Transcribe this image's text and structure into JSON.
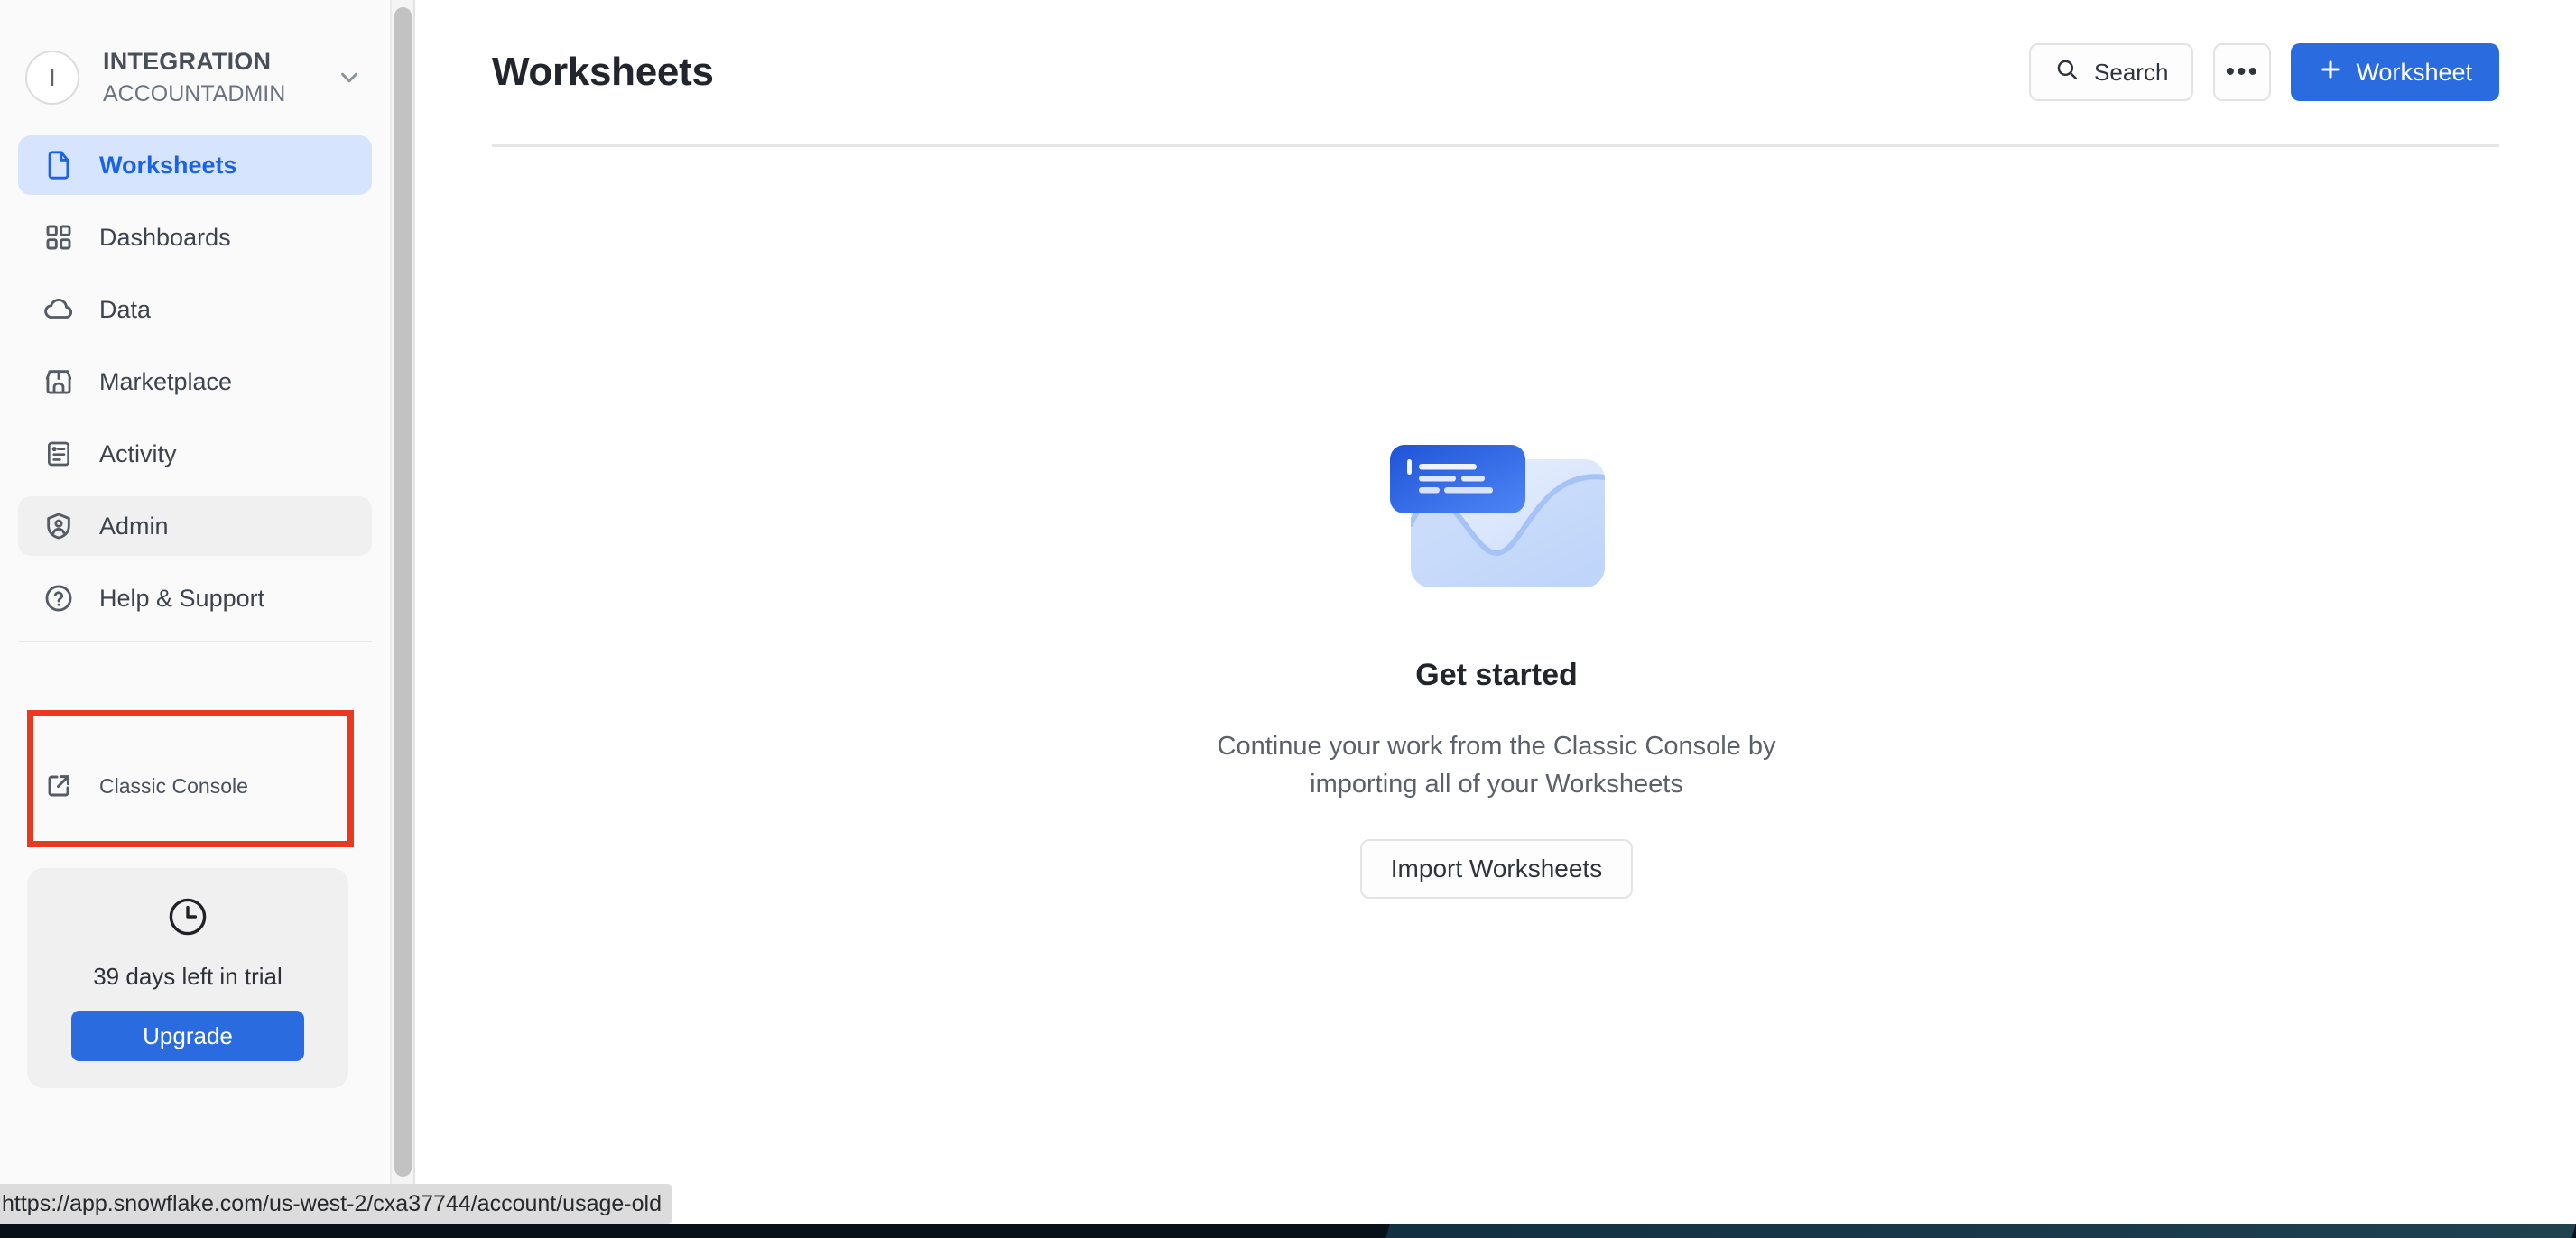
{
  "sidebar": {
    "account": {
      "avatar_initial": "I",
      "name": "INTEGRATION",
      "role": "ACCOUNTADMIN",
      "chevron_icon": "chevron-down-icon"
    },
    "nav_items": [
      {
        "label": "Worksheets",
        "icon": "file-icon",
        "state": "active"
      },
      {
        "label": "Dashboards",
        "icon": "grid-icon",
        "state": "default"
      },
      {
        "label": "Data",
        "icon": "cloud-icon",
        "state": "default"
      },
      {
        "label": "Marketplace",
        "icon": "storefront-icon",
        "state": "default"
      },
      {
        "label": "Activity",
        "icon": "list-doc-icon",
        "state": "default"
      },
      {
        "label": "Admin",
        "icon": "shield-user-icon",
        "state": "hovered"
      },
      {
        "label": "Help & Support",
        "icon": "question-circle-icon",
        "state": "default"
      }
    ],
    "classic_console": {
      "label": "Classic Console",
      "icon": "external-link-icon",
      "highlighted": true,
      "highlight_color": "#e93a20"
    },
    "trial": {
      "icon": "clock-icon",
      "text": "39 days left in trial",
      "upgrade_label": "Upgrade"
    },
    "scrollbar": {
      "name": "sidebar-scrollbar"
    }
  },
  "header": {
    "title": "Worksheets",
    "search_label": "Search",
    "search_icon": "search-icon",
    "more_label": "•••",
    "more_icon": "ellipsis-icon",
    "new_worksheet_label": "Worksheet",
    "plus_icon": "plus-icon"
  },
  "empty_state": {
    "illustration": "worksheet-illustration",
    "title": "Get started",
    "description": "Continue your work from the Classic Console by importing all of your Worksheets",
    "import_label": "Import Worksheets"
  },
  "status_bar": {
    "url": "https://app.snowflake.com/us-west-2/cxa37744/account/usage-old"
  },
  "colors": {
    "accent_blue": "#2a6ce0",
    "active_nav_bg": "#d6e4fd",
    "active_nav_fg": "#1a62e8",
    "annotation_red": "#e93a20",
    "sidebar_bg": "#fafafa"
  }
}
